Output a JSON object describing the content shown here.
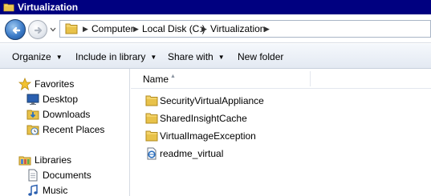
{
  "window": {
    "title": "Virtualization"
  },
  "address": {
    "crumbs": [
      "Computer",
      "Local Disk (C:)",
      "Virtualization"
    ]
  },
  "toolbar": {
    "organize": "Organize",
    "include_in_library": "Include in library",
    "share_with": "Share with",
    "new_folder": "New folder"
  },
  "sidebar": {
    "favorites": {
      "label": "Favorites",
      "items": [
        {
          "label": "Desktop",
          "icon": "desktop-icon"
        },
        {
          "label": "Downloads",
          "icon": "downloads-icon"
        },
        {
          "label": "Recent Places",
          "icon": "recent-places-icon"
        }
      ]
    },
    "libraries": {
      "label": "Libraries",
      "items": [
        {
          "label": "Documents",
          "icon": "documents-icon"
        },
        {
          "label": "Music",
          "icon": "music-icon"
        }
      ]
    }
  },
  "content": {
    "columns": {
      "name": "Name"
    },
    "files": [
      {
        "name": "SecurityVirtualAppliance",
        "type": "folder"
      },
      {
        "name": "SharedInsightCache",
        "type": "folder"
      },
      {
        "name": "VirtualImageException",
        "type": "folder"
      },
      {
        "name": "readme_virtual",
        "type": "html-document"
      }
    ]
  },
  "colors": {
    "titlebar": "#000080",
    "folder": "#e8c24a",
    "accent": "#3d7cc8"
  }
}
